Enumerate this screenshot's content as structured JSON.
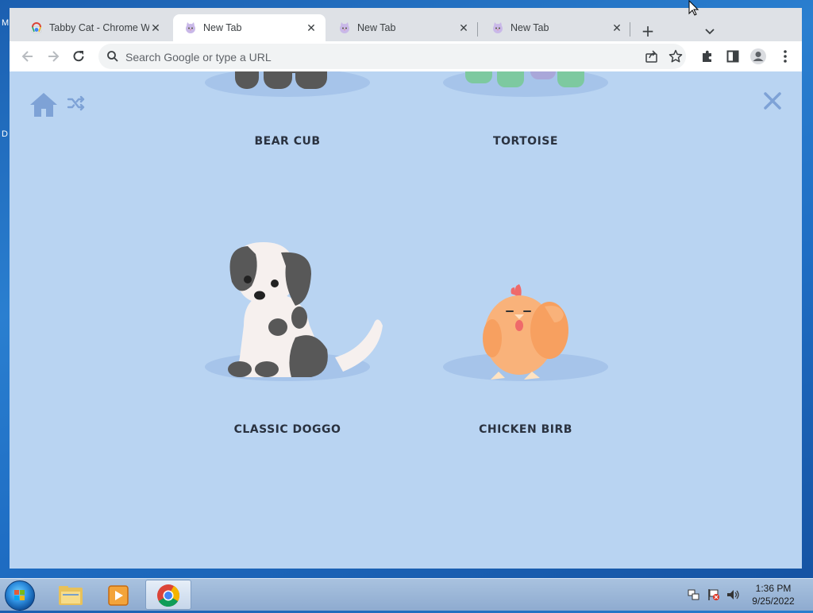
{
  "desktop": {
    "edge_label_1": "M",
    "edge_label_2": "D"
  },
  "browser": {
    "tabs": [
      {
        "title": "Tabby Cat - Chrome Web Store",
        "favicon": "chrome-web-store-icon",
        "active": false
      },
      {
        "title": "New Tab",
        "favicon": "tabby-cat-icon",
        "active": true
      },
      {
        "title": "New Tab",
        "favicon": "tabby-cat-icon",
        "active": false
      },
      {
        "title": "New Tab",
        "favicon": "tabby-cat-icon",
        "active": false
      }
    ],
    "omnibox": {
      "placeholder": "Search Google or type a URL",
      "value": ""
    }
  },
  "page": {
    "background_color": "#b9d4f2",
    "animals": [
      {
        "name": "BEAR CUB"
      },
      {
        "name": "TORTOISE"
      },
      {
        "name": "CLASSIC DOGGO"
      },
      {
        "name": "CHICKEN BIRB"
      }
    ]
  },
  "taskbar": {
    "apps": [
      "windows-explorer-icon",
      "media-player-icon",
      "chrome-icon"
    ],
    "clock": {
      "time": "1:36 PM",
      "date": "9/25/2022"
    }
  }
}
